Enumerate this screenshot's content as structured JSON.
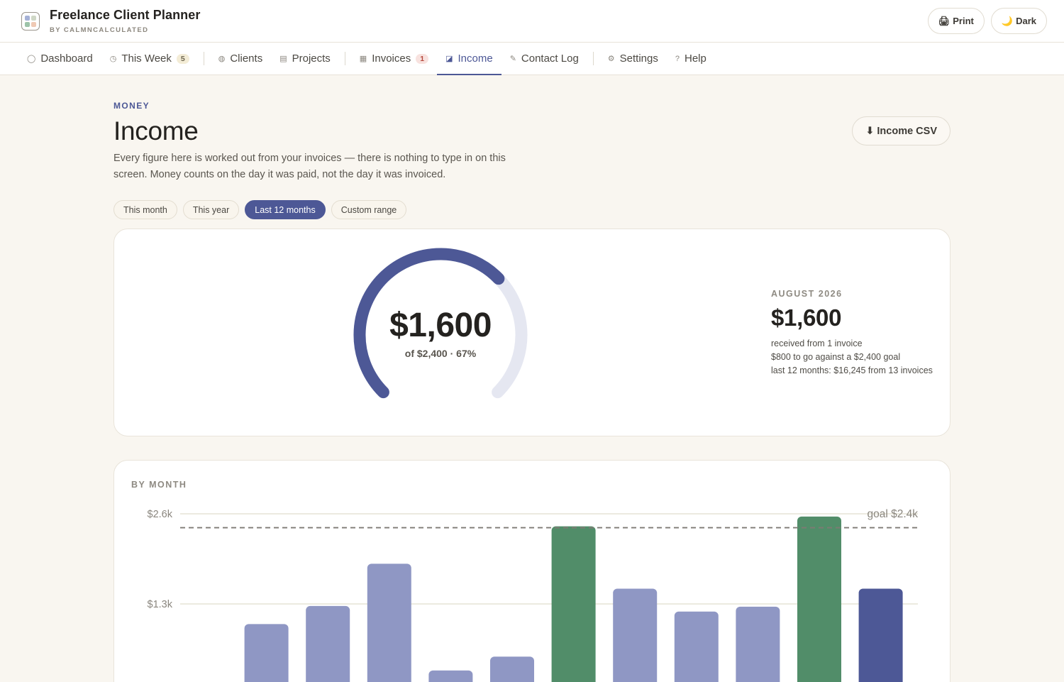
{
  "app": {
    "title": "Freelance Client Planner",
    "subtitle": "BY CALMNCALCULATED"
  },
  "top_actions": {
    "print": "Print",
    "print_icon": "printer-icon",
    "dark": "Dark",
    "dark_icon": "moon-icon"
  },
  "tabs": [
    {
      "label": "Dashboard",
      "icon": "◯",
      "badge": ""
    },
    {
      "label": "This Week",
      "icon": "◷",
      "badge": "5"
    },
    {
      "label": "Clients",
      "icon": "◍",
      "badge": ""
    },
    {
      "label": "Projects",
      "icon": "▤",
      "badge": ""
    },
    {
      "label": "Invoices",
      "icon": "▦",
      "badge": "1"
    },
    {
      "label": "Income",
      "icon": "◪",
      "badge": ""
    },
    {
      "label": "Contact Log",
      "icon": "✎",
      "badge": ""
    },
    {
      "label": "Settings",
      "icon": "⚙",
      "badge": ""
    },
    {
      "label": "Help",
      "icon": "?",
      "badge": ""
    }
  ],
  "active_tab": "Income",
  "page": {
    "eyebrow": "MONEY",
    "title": "Income",
    "description": "Every figure here is worked out from your invoices — there is nothing to type in on this screen. Money counts on the day it was paid, not the day it was invoiced.",
    "csv_button": "⬇ Income CSV"
  },
  "filters": [
    "This month",
    "This year",
    "Last 12 months",
    "Custom range"
  ],
  "active_filter": "Last 12 months",
  "gauge": {
    "value": "$1,600",
    "sub": "of $2,400 · 67%",
    "percent": 67
  },
  "stats": {
    "label": "AUGUST 2026",
    "value": "$1,600",
    "line1": "received from 1 invoice",
    "line2": "$800 to go against a $2,400 goal",
    "line3": "last 12 months: $16,245 from 13 invoices"
  },
  "chart_data": {
    "type": "bar",
    "title": "BY MONTH",
    "y_ticks": [
      "$2.6k",
      "$1.3k"
    ],
    "y_tick_values": [
      2600,
      1300
    ],
    "goal": 2400,
    "goal_label": "goal $2.4k",
    "values": [
      0,
      1010,
      1270,
      1880,
      340,
      540,
      2420,
      1520,
      1190,
      1260,
      2560,
      1520
    ],
    "bar_status": [
      "under",
      "under",
      "under",
      "under",
      "under",
      "under",
      "met",
      "under",
      "under",
      "under",
      "met",
      "current"
    ],
    "colors": {
      "under": "#8f97c4",
      "met": "#518d69",
      "current": "#4d5896",
      "goal_line": "#7d7a74",
      "grid": "#e6e3d6"
    }
  }
}
